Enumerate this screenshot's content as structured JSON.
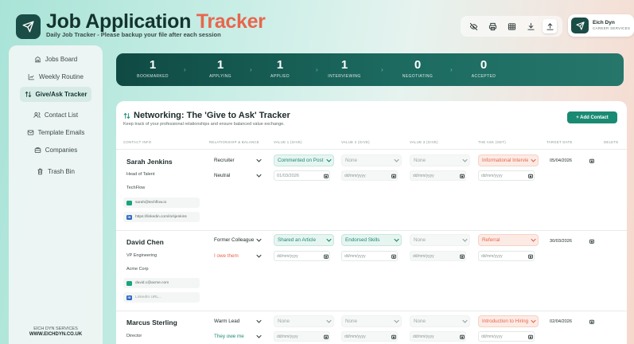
{
  "header": {
    "title_main": "Job Application",
    "title_accent": "Tracker",
    "subtitle": "Daily Job Tracker - Please backup your file after each session",
    "toolbar_icons": [
      "eye-off-icon",
      "print-icon",
      "table-icon",
      "download-icon",
      "upload-icon"
    ],
    "brand_name": "Eich Dyn",
    "brand_tagline": "CAREER SERVICES"
  },
  "sidebar": {
    "items": [
      {
        "label": "Jobs Board",
        "icon": "building-icon",
        "active": false
      },
      {
        "label": "Weekly Routine",
        "icon": "chart-icon",
        "active": false
      },
      {
        "label": "Give/Ask Tracker",
        "icon": "swap-icon",
        "active": true
      },
      {
        "label": "Contact List",
        "icon": "users-icon",
        "active": false
      },
      {
        "label": "Template Emails",
        "icon": "mail-icon",
        "active": false
      },
      {
        "label": "Companies",
        "icon": "briefcase-icon",
        "active": false
      },
      {
        "label": "Trash Bin",
        "icon": "trash-icon",
        "active": false
      }
    ],
    "footer_line1": "EICH DYN SERVICES",
    "footer_line2": "WWW.EICHDYN.CO.UK"
  },
  "pipeline": {
    "stages": [
      {
        "count": "1",
        "label": "BOOKMARKED"
      },
      {
        "count": "1",
        "label": "APPLYING"
      },
      {
        "count": "1",
        "label": "APPLIED"
      },
      {
        "count": "1",
        "label": "INTERVIEWING"
      },
      {
        "count": "0",
        "label": "NEGOTIATING"
      },
      {
        "count": "0",
        "label": "ACCEPTED"
      }
    ]
  },
  "tracker": {
    "title": "Networking: The 'Give to Ask' Tracker",
    "subtitle": "Keep track of your professional relationships and ensure balanced value exchange.",
    "add_button": "+ Add Contact",
    "columns": [
      "CONTACT INFO",
      "RELATIONSHIP & BALANCE",
      "VALUE 1 (GIVE)",
      "VALUE 2 (GIVE)",
      "VALUE 3 (GIVE)",
      "THE ASK (GET)",
      "TARGET DATE",
      "DELETE"
    ],
    "date_placeholder": "dd/mm/yyyy",
    "contacts": [
      {
        "name": "Sarah Jenkins",
        "role": "Head of Talent",
        "company": "TechFlow",
        "email": "sarah@techflow.io",
        "linkedin": "https://linkedin.com/in/sjenkins",
        "relationship": "Recruiter",
        "balance": "Neutral",
        "give1": "Commented on Post",
        "give1_date": "01/03/2026",
        "give2": "None",
        "give3": "None",
        "ask": "Informational Interview",
        "target_date": "05/04/2026"
      },
      {
        "name": "David Chen",
        "role": "VP Engineering",
        "company": "Acme Corp",
        "email": "david.c@acme.com",
        "linkedin": "LinkedIn URL...",
        "relationship": "Former Colleague",
        "balance": "I owe them",
        "give1": "Shared an Article",
        "give1_date": "dd/mm/yyyy",
        "give2": "Endorsed Skills",
        "give3": "None",
        "ask": "Referral",
        "target_date": "30/03/2026"
      },
      {
        "name": "Marcus Sterling",
        "role": "Director",
        "company": "",
        "email": "",
        "linkedin": "",
        "relationship": "Warm Lead",
        "balance": "They owe me",
        "give1": "None",
        "give1_date": "dd/mm/yyyy",
        "give2": "None",
        "give3": "None",
        "ask": "Introduction to Hiring Manager",
        "target_date": "02/04/2026"
      }
    ]
  },
  "colors": {
    "accent_orange": "#e8664c",
    "brand_teal": "#1a4d46",
    "give_green": "#1a8a73"
  }
}
